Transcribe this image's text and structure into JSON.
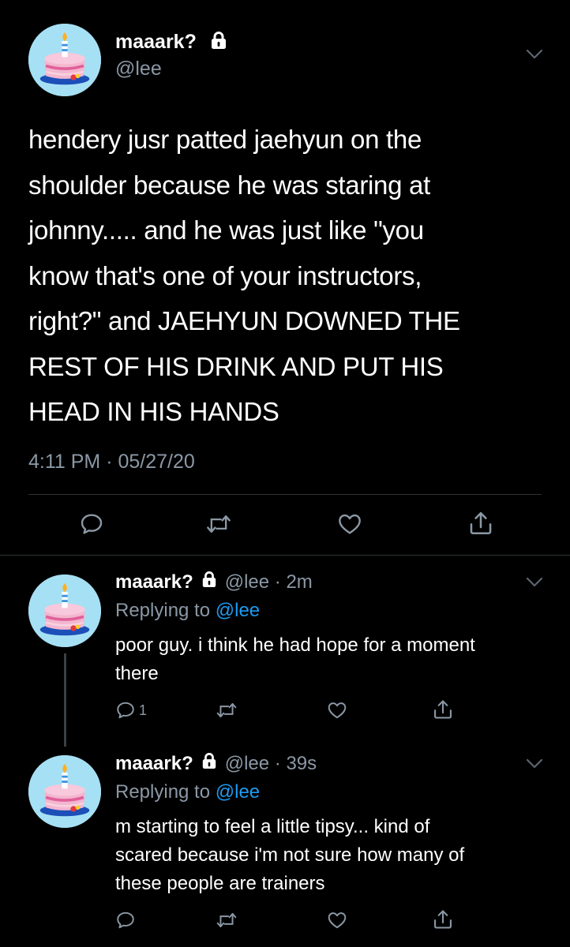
{
  "main_tweet": {
    "display_name": "maaark?",
    "handle": "@lee",
    "text_lines": [
      "hendery jusr patted jaehyun on the",
      "shoulder because he was staring at",
      "johnny..... and he was just like \"you",
      "know that's one of your instructors,",
      "right?\" and JAEHYUN DOWNED THE",
      "REST OF HIS DRINK AND PUT HIS",
      "HEAD IN HIS HANDS"
    ],
    "timestamp": "4:11 PM · 05/27/20",
    "actions": [
      "reply-icon",
      "retweet-icon",
      "like-icon",
      "share-icon"
    ]
  },
  "replies": [
    {
      "display_name": "maaark?",
      "handle_time": "@lee · 2m",
      "replying_prefix": "Replying to ",
      "replying_to": "@lee",
      "text_lines": [
        "poor guy. i think he had hope for a moment",
        "there"
      ],
      "reply_count": "1"
    },
    {
      "display_name": "maaark?",
      "handle_time": "@lee · 39s",
      "replying_prefix": "Replying to ",
      "replying_to": "@lee",
      "text_lines": [
        "m starting to feel a little tipsy... kind of",
        "scared because i'm not sure how many of",
        "these people are trainers"
      ],
      "reply_count": ""
    }
  ],
  "colors": {
    "background": "#000000",
    "text": "#ffffff",
    "secondary_text": "#8b98a5",
    "mention": "#1d9bf0",
    "divider": "#2f3336",
    "avatar_bg": "#a6e0f4"
  }
}
